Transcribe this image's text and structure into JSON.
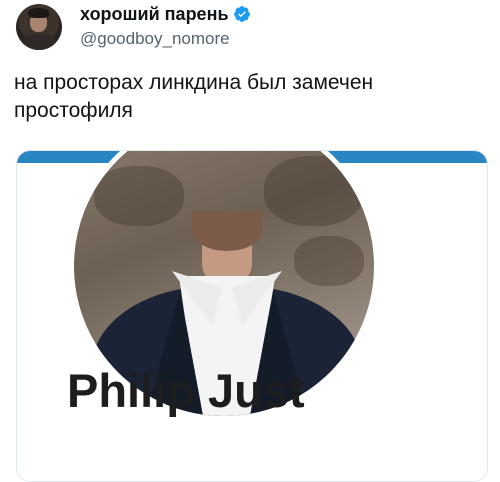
{
  "author": {
    "display_name": "хороший парень",
    "handle": "@goodboy_nomore",
    "verified": true
  },
  "tweet": {
    "text": "на просторах линкдина был замечен простофиля"
  },
  "card": {
    "profile_name": "Philip Just"
  },
  "colors": {
    "banner": "#2a86c3",
    "verified": "#1d9bf0",
    "handle": "#536471"
  }
}
